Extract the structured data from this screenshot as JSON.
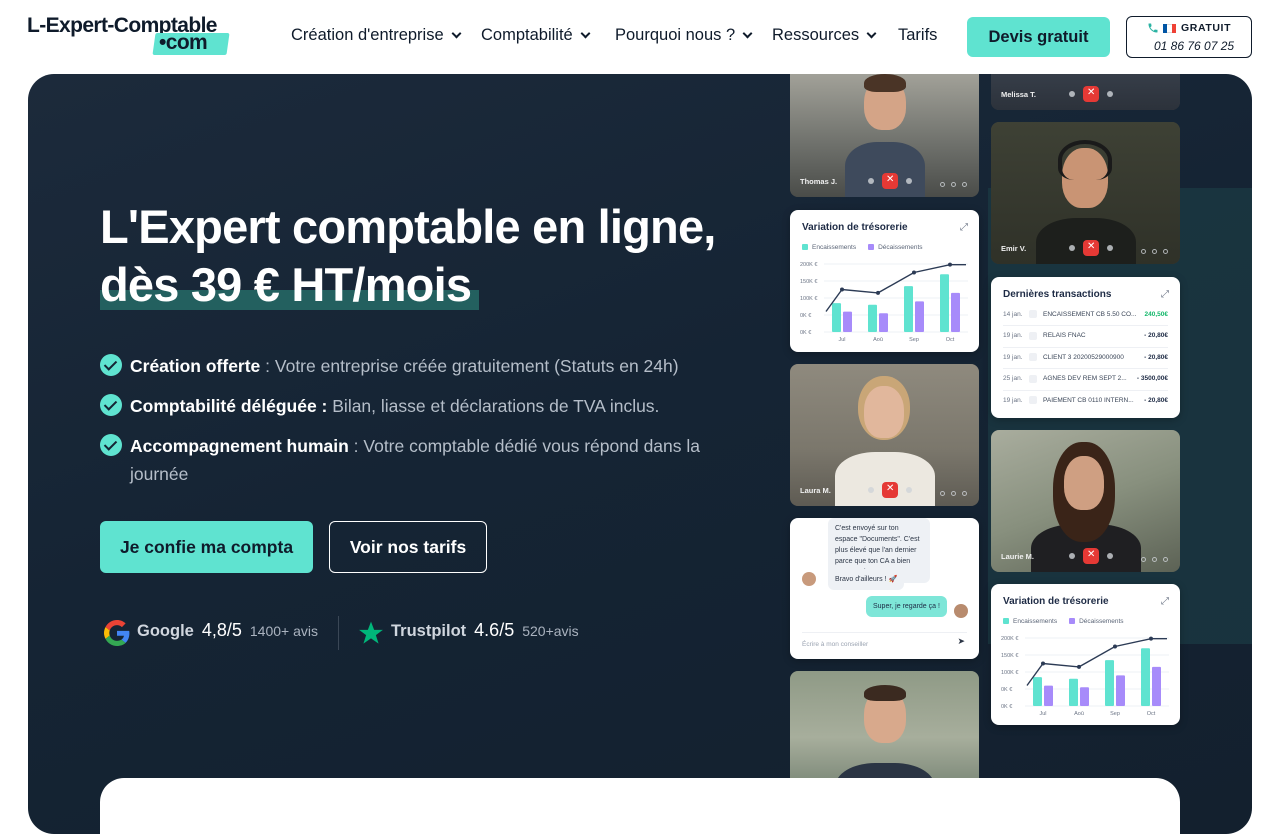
{
  "nav": {
    "logo_line1": "L-Expert-Comptable",
    "logo_line2": "•com",
    "items": [
      {
        "label": "Création d'entreprise",
        "has_dropdown": true
      },
      {
        "label": "Comptabilité",
        "has_dropdown": true
      },
      {
        "label": "Pourquoi nous ?",
        "has_dropdown": true
      },
      {
        "label": "Ressources",
        "has_dropdown": true
      },
      {
        "label": "Tarifs",
        "has_dropdown": false
      }
    ],
    "cta_label": "Devis gratuit",
    "phone_badge": "GRATUIT",
    "phone_number": "01 86 76 07 25",
    "phone_icon": "phone-icon",
    "flag_icon": "france-flag-icon"
  },
  "hero": {
    "title_line1": "L'Expert comptable en ligne,",
    "title_line2": "dès 39 € HT/mois",
    "features": [
      {
        "bold": "Création offerte",
        "text": " : Votre entreprise créée gratuitement (Statuts en 24h)"
      },
      {
        "bold": "Comptabilité déléguée :",
        "text": " Bilan, liasse et déclarations de TVA inclus."
      },
      {
        "bold": "Accompagnement humain",
        "text": " : Votre comptable dédié vous répond dans la",
        "text_line2": "journée"
      }
    ],
    "cta_primary": "Je confie ma compta",
    "cta_secondary": "Voir nos tarifs",
    "ratings": [
      {
        "name": "Google",
        "score": "4,8/5",
        "count": "1400+ avis",
        "icon": "google-icon"
      },
      {
        "name": "Trustpilot",
        "score": "4.6/5",
        "count": "520+avis",
        "icon": "trustpilot-star-icon"
      }
    ]
  },
  "mosaic": {
    "video_names": [
      "Thomas J.",
      "Emir V.",
      "Laura M.",
      "Laurie M.",
      "Melissa T."
    ],
    "treasury_title": "Variation de trésorerie",
    "legend": [
      "Encaissements",
      "Décaissements"
    ],
    "transactions_title": "Dernières transactions",
    "transactions": [
      {
        "date": "14 jan.",
        "label": "ENCAISSEMENT CB 5.50 CO...",
        "amount": "240,50€",
        "positive": true
      },
      {
        "date": "19 jan.",
        "label": "RELAIS FNAC",
        "amount": "- 20,80€",
        "positive": false
      },
      {
        "date": "19 jan.",
        "label": "CLIENT 3 20200529000900",
        "amount": "- 20,80€",
        "positive": false
      },
      {
        "date": "25 jan.",
        "label": "AGNES DEV REM SEPT 2...",
        "amount": "- 3500,00€",
        "positive": false
      },
      {
        "date": "19 jan.",
        "label": "PAIEMENT CB 0110 INTERN...",
        "amount": "- 20,80€",
        "positive": false
      }
    ],
    "chat": {
      "msg1": "C'est envoyé sur ton espace \"Documents\". C'est plus élevé que l'an dernier parce que ton CA a bien progressé.",
      "msg2": "Bravo d'ailleurs ! 🚀",
      "msg3": "Super, je regarde ça !",
      "placeholder": "Écrire à mon conseiller"
    },
    "colors": {
      "encaissements": "#5fe3d0",
      "decaissements": "#a78bfa",
      "line": "#2c3b55"
    }
  },
  "chart_data": {
    "type": "bar",
    "title": "Variation de trésorerie",
    "categories": [
      "Jul",
      "Aoû",
      "Sep",
      "Oct"
    ],
    "y_tick_labels": [
      "200K €",
      "150K €",
      "100K €",
      "0K €",
      "0K €"
    ],
    "series": [
      {
        "name": "Encaissements",
        "values": [
          85,
          80,
          135,
          170
        ]
      },
      {
        "name": "Décaissements",
        "values": [
          60,
          55,
          90,
          115
        ]
      }
    ],
    "line_values": [
      125,
      115,
      175,
      198
    ],
    "ylim": [
      0,
      200
    ],
    "legend_position": "top-left"
  }
}
